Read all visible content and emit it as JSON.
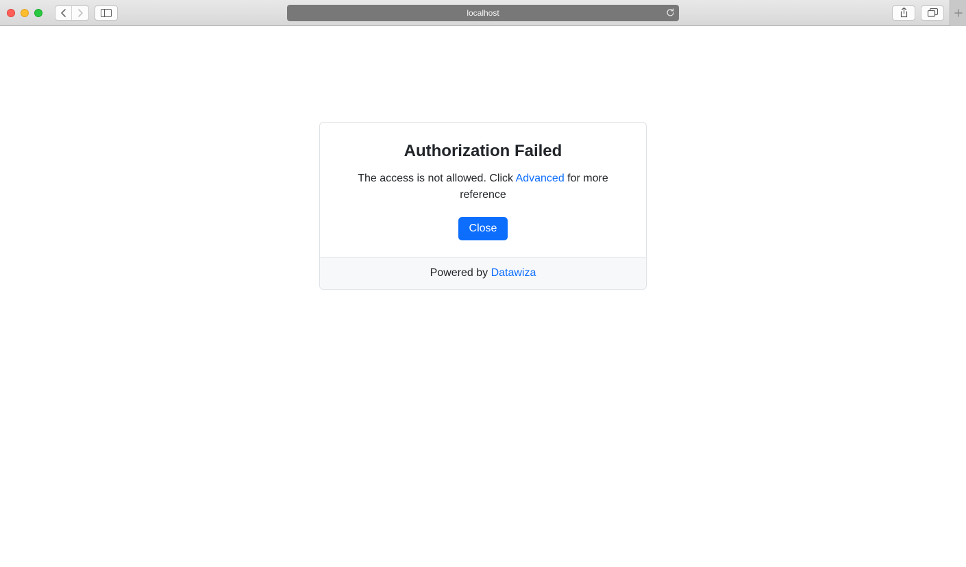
{
  "browser": {
    "address": "localhost"
  },
  "dialog": {
    "title": "Authorization Failed",
    "message_prefix": "The access is not allowed. Click ",
    "advanced_link": "Advanced",
    "message_suffix": " for more reference",
    "close_label": "Close"
  },
  "footer": {
    "powered_by_prefix": "Powered by ",
    "brand": "Datawiza"
  }
}
